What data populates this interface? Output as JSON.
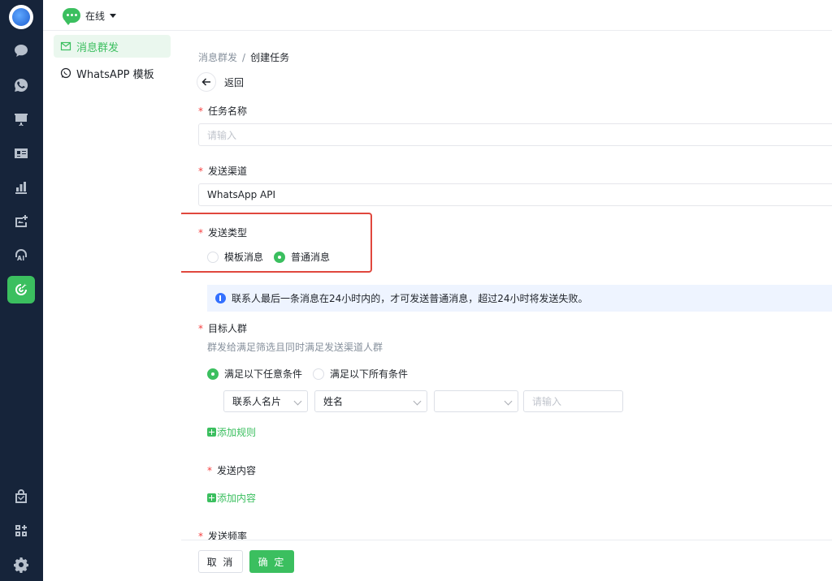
{
  "topbar": {
    "status_label": "在线"
  },
  "sidebar": {
    "items": [
      {
        "label": "消息群发",
        "active": true
      },
      {
        "label": "WhatsAPP 模板",
        "active": false
      }
    ]
  },
  "breadcrumb": {
    "parent": "消息群发",
    "separator": "/",
    "current": "创建任务"
  },
  "back_label": "返回",
  "form": {
    "task_name": {
      "label": "任务名称",
      "placeholder": "请输入"
    },
    "channel": {
      "label": "发送渠道",
      "value": "WhatsApp API"
    },
    "send_type": {
      "label": "发送类型",
      "options": [
        {
          "label": "模板消息",
          "selected": false
        },
        {
          "label": "普通消息",
          "selected": true
        }
      ]
    },
    "info_text": "联系人最后一条消息在24小时内的，才可发送普通消息，超过24小时将发送失败。",
    "target": {
      "label": "目标人群",
      "hint": "群发给满足筛选且同时满足发送渠道人群",
      "match_options": [
        {
          "label": "满足以下任意条件",
          "selected": true
        },
        {
          "label": "满足以下所有条件",
          "selected": false
        }
      ],
      "rule": {
        "field_group": "联系人名片",
        "field": "姓名",
        "operator": "",
        "value_placeholder": "请输入"
      },
      "add_rule_label": "添加规则"
    },
    "content": {
      "label": "发送内容",
      "add_label": "添加内容"
    },
    "frequency": {
      "label": "发送频率"
    }
  },
  "footer": {
    "cancel_label": "取 消",
    "ok_label": "确 定"
  },
  "colors": {
    "accent": "#3bbf5f",
    "rail": "#16243a",
    "required": "#f53f3f",
    "highlight_border": "#e0473d",
    "info_bg": "#eef4ff"
  }
}
